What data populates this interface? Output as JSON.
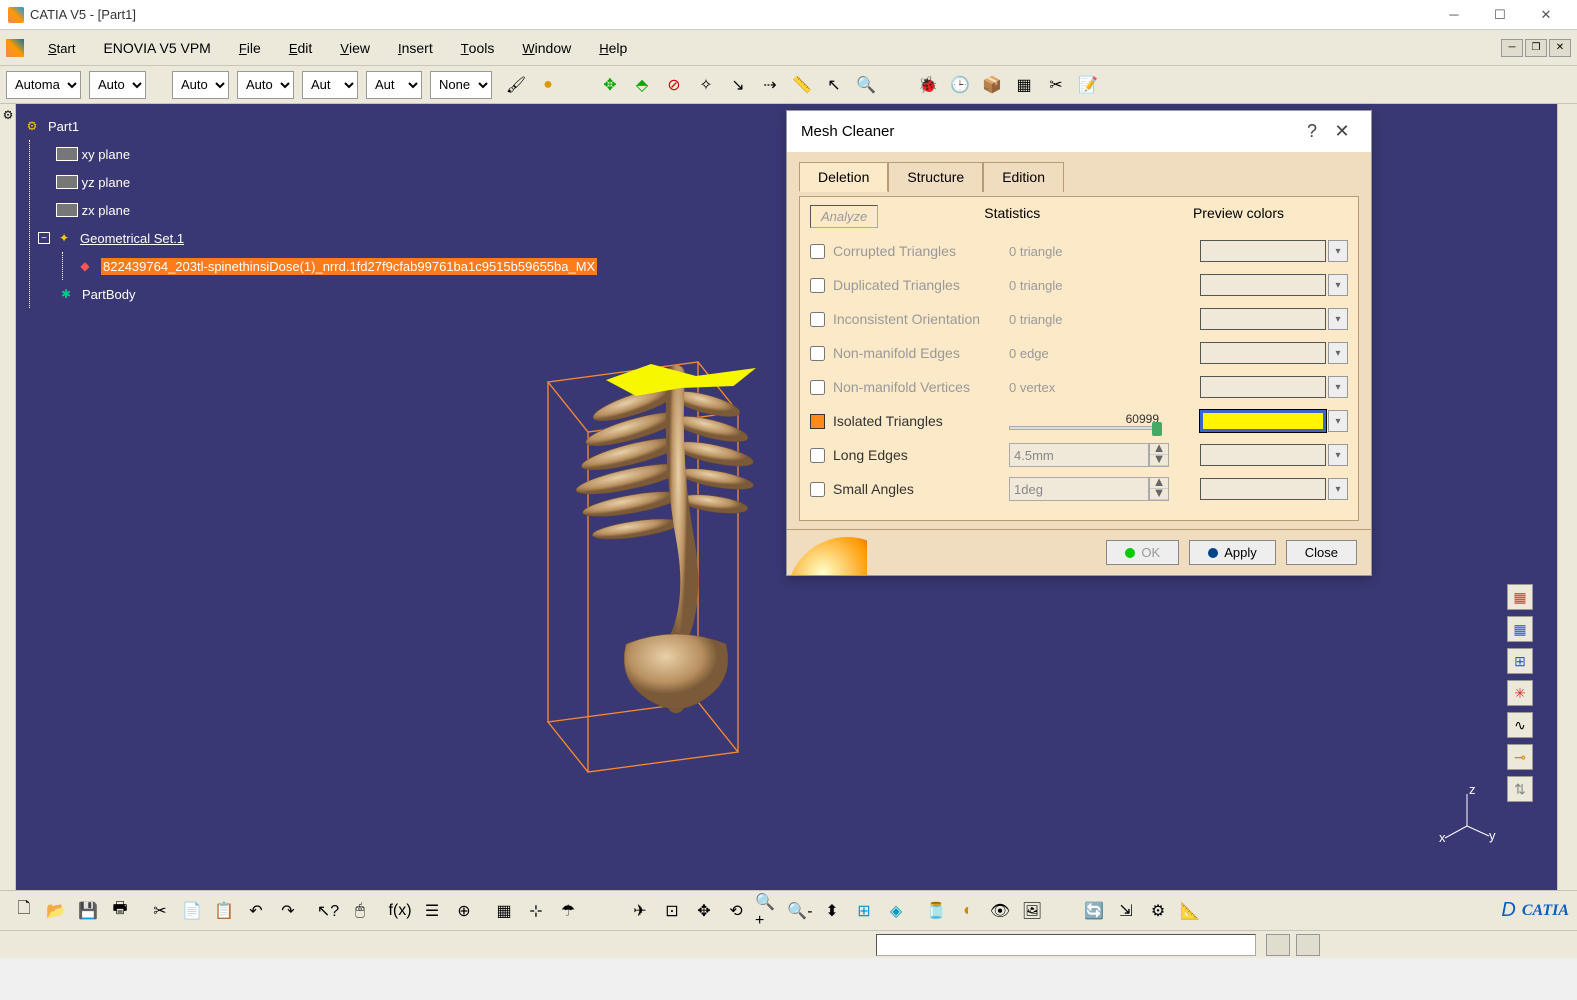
{
  "window": {
    "title": "CATIA V5 - [Part1]"
  },
  "menu": {
    "start": "Start",
    "enovia": "ENOVIA V5 VPM",
    "file": "File",
    "edit": "Edit",
    "view": "View",
    "insert": "Insert",
    "tools": "Tools",
    "window": "Window",
    "help": "Help"
  },
  "dropdowns": {
    "d0": "Automa",
    "d1": "Auto",
    "d2": "Auto",
    "d3": "Auto",
    "d4": "Aut",
    "d5": "Aut",
    "d6": "None"
  },
  "tree": {
    "root": "Part1",
    "xy": "xy plane",
    "yz": "yz plane",
    "zx": "zx plane",
    "geoset": "Geometrical Set.1",
    "item": "822439764_203tl-spinethinsiDose(1)_nrrd.1fd27f9cfab99761ba1c9515b59655ba_MX",
    "partbody": "PartBody"
  },
  "axis": {
    "x": "x",
    "y": "y",
    "z": "z"
  },
  "dialog": {
    "title": "Mesh Cleaner",
    "tabs": {
      "deletion": "Deletion",
      "structure": "Structure",
      "edition": "Edition"
    },
    "analyze": "Analyze",
    "stats_hdr": "Statistics",
    "preview_hdr": "Preview colors",
    "rows": {
      "corrupted": {
        "label": "Corrupted Triangles",
        "stat": "0 triangle"
      },
      "duplicated": {
        "label": "Duplicated Triangles",
        "stat": "0 triangle"
      },
      "inconsistent": {
        "label": "Inconsistent Orientation",
        "stat": "0 triangle"
      },
      "nme": {
        "label": "Non-manifold Edges",
        "stat": "0 edge"
      },
      "nmv": {
        "label": "Non-manifold Vertices",
        "stat": "0 vertex"
      },
      "isolated": {
        "label": "Isolated Triangles",
        "count": "60999"
      },
      "longedges": {
        "label": "Long Edges",
        "value": "4.5mm"
      },
      "smallangles": {
        "label": "Small Angles",
        "value": "1deg"
      }
    },
    "buttons": {
      "ok": "OK",
      "apply": "Apply",
      "close": "Close"
    }
  }
}
